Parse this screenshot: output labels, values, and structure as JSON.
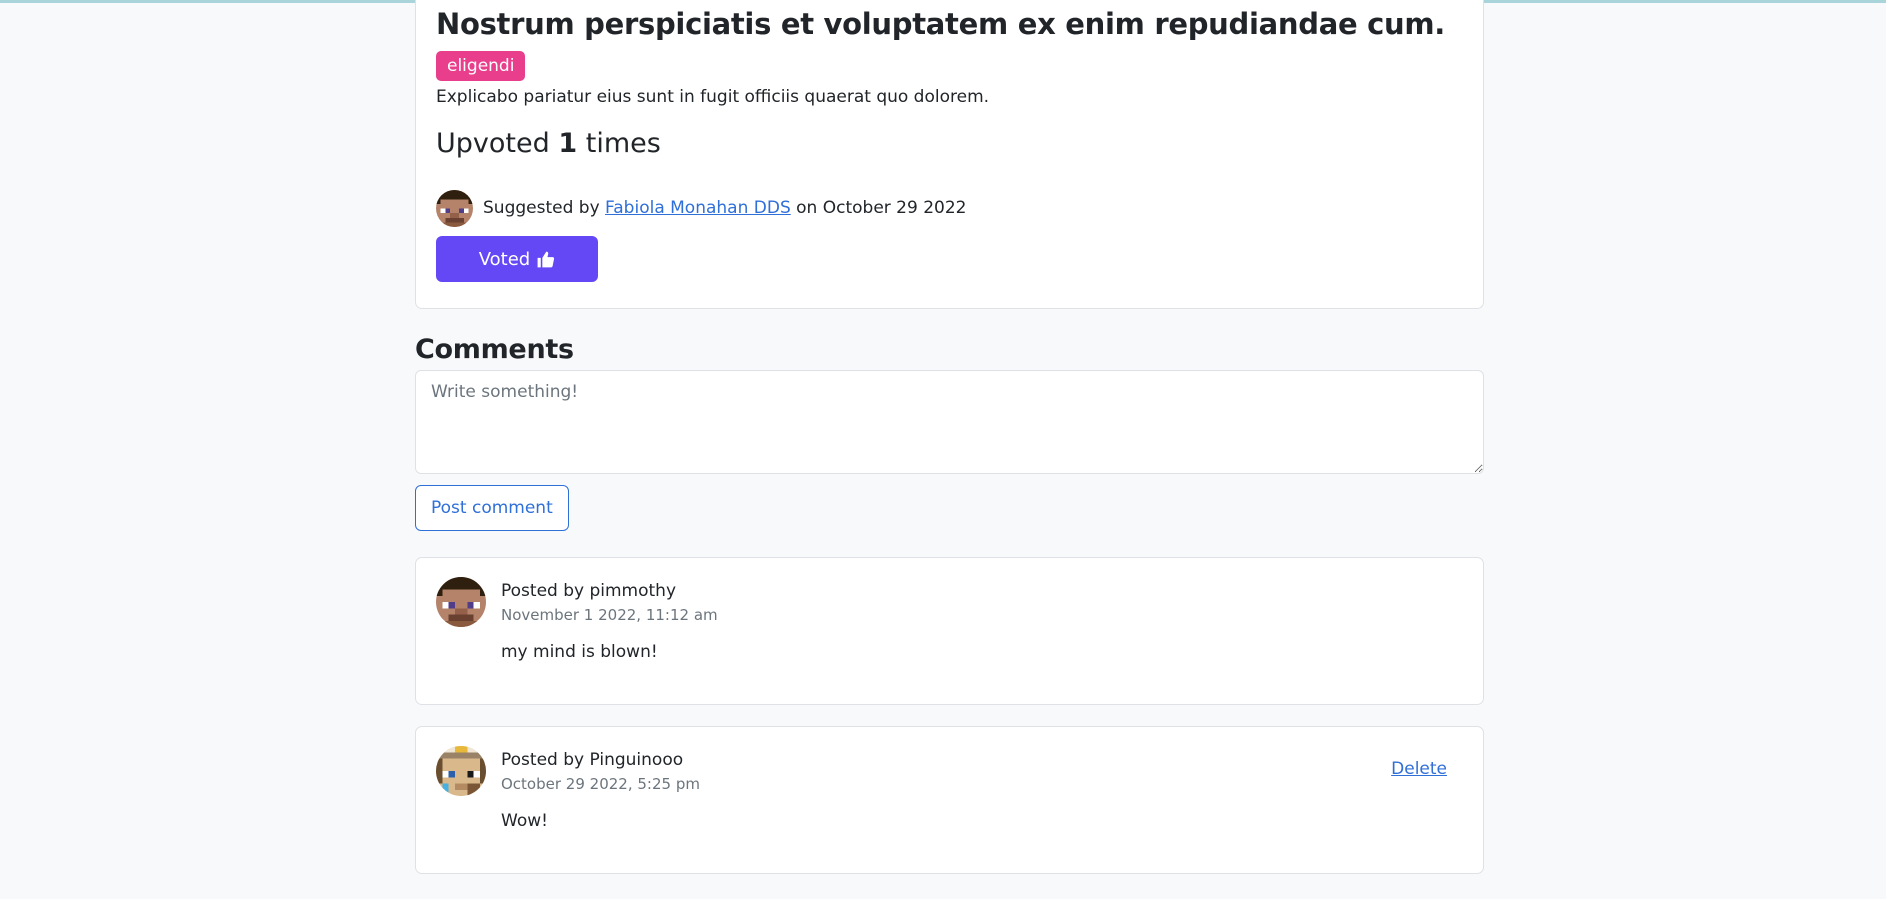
{
  "suggestion": {
    "title": "Nostrum perspiciatis et voluptatem ex enim repudiandae cum.",
    "category": "eligendi",
    "description": "Explicabo pariatur eius sunt in fugit officiis quaerat quo dolorem.",
    "upvote_prefix": "Upvoted",
    "upvote_count": "1",
    "upvote_suffix": "times",
    "suggested_prefix": "Suggested by",
    "author": "Fabiola Monahan DDS",
    "date_text": "on October 29 2022",
    "vote_button_label": "Voted"
  },
  "comments_section": {
    "heading": "Comments",
    "textarea_placeholder": "Write something!",
    "post_button_label": "Post comment"
  },
  "comments": [
    {
      "posted_by": "Posted by pimmothy",
      "date": "November 1 2022, 11:12 am",
      "body": "my mind is blown!"
    },
    {
      "posted_by": "Posted by Pinguinooo",
      "date": "October 29 2022, 5:25 pm",
      "body": "Wow!",
      "delete_label": "Delete"
    }
  ],
  "colors": {
    "badge": "#e83e8c",
    "primary_button": "#6548f5",
    "link": "#2f6fd8"
  },
  "icons": {
    "vote_icon": "thumbs-up-icon"
  }
}
